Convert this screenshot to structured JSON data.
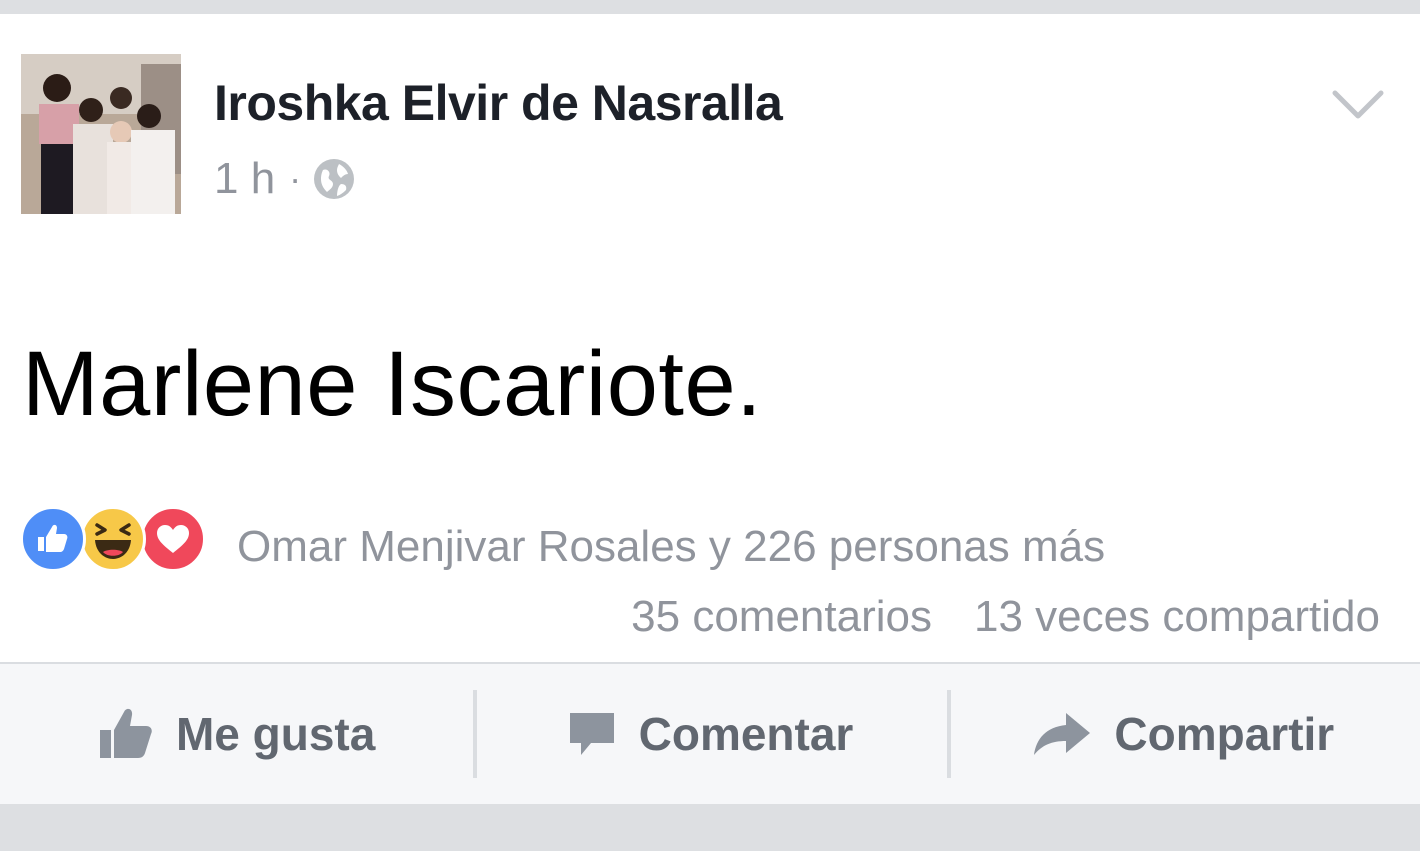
{
  "post": {
    "author_name": "Iroshka Elvir de Nasralla",
    "time_ago": "1 h",
    "separator": "·",
    "privacy_icon": "globe-icon",
    "text": "Marlene Iscariote."
  },
  "reactions": {
    "icons": [
      "like-reaction-icon",
      "haha-reaction-icon",
      "love-reaction-icon"
    ],
    "summary": "Omar Menjivar Rosales y 226 personas más",
    "comments": "35 comentarios",
    "shares": "13 veces compartido",
    "colors": {
      "like": "#4f8ef7",
      "haha": "#f7c848",
      "love": "#f0485b"
    }
  },
  "actions": {
    "like_label": "Me gusta",
    "comment_label": "Comentar",
    "share_label": "Compartir"
  },
  "colors": {
    "text_primary": "#1d2129",
    "text_secondary": "#90949c",
    "action_text": "#616770",
    "background": "#dddfe2"
  }
}
